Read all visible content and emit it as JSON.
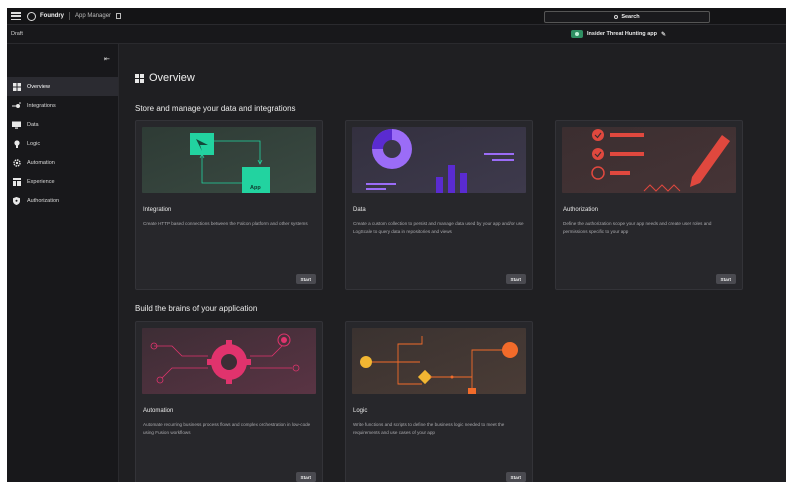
{
  "topbar": {
    "brand": "Foundry",
    "app_manager": "App Manager",
    "search_label": "Search"
  },
  "subbar": {
    "status": "Draft",
    "app_name": "Insider Threat Hunting app"
  },
  "sidebar": {
    "items": [
      {
        "label": "Overview",
        "icon": "grid-icon",
        "active": true
      },
      {
        "label": "Integrations",
        "icon": "integrations-icon",
        "active": false
      },
      {
        "label": "Data",
        "icon": "data-icon",
        "active": false
      },
      {
        "label": "Logic",
        "icon": "logic-icon",
        "active": false
      },
      {
        "label": "Automation",
        "icon": "automation-icon",
        "active": false
      },
      {
        "label": "Experience",
        "icon": "experience-icon",
        "active": false
      },
      {
        "label": "Authorization",
        "icon": "shield-icon",
        "active": false
      }
    ]
  },
  "main": {
    "title": "Overview",
    "sections": [
      {
        "title": "Store and manage your data and integrations",
        "cards": [
          {
            "title": "Integration",
            "description": "Create HTTP based connections between the Falcon platform and other systems",
            "button": "Start",
            "art_label": "App"
          },
          {
            "title": "Data",
            "description": "Create a custom collection to persist and manage data used by your app and/or use LogScale to query data in repositories and views",
            "button": "Start"
          },
          {
            "title": "Authorization",
            "description": "Define the authorization scope your app needs and create user roles and permissions specific to your app",
            "button": "Start"
          }
        ]
      },
      {
        "title": "Build the brains of your application",
        "cards": [
          {
            "title": "Automation",
            "description": "Automate recurring business process flows and complex orchestration in low-code using Fusion workflows",
            "button": "Start"
          },
          {
            "title": "Logic",
            "description": "Write functions and scripts to define the business logic needed to meet the requirements and use cases of your app",
            "button": "Start"
          }
        ]
      }
    ]
  },
  "colors": {
    "background": "#1f1f22",
    "accent_green": "#22d3a0",
    "accent_purple": "#7b3ff2",
    "accent_red": "#e0483e",
    "accent_orange": "#f26b2a"
  }
}
